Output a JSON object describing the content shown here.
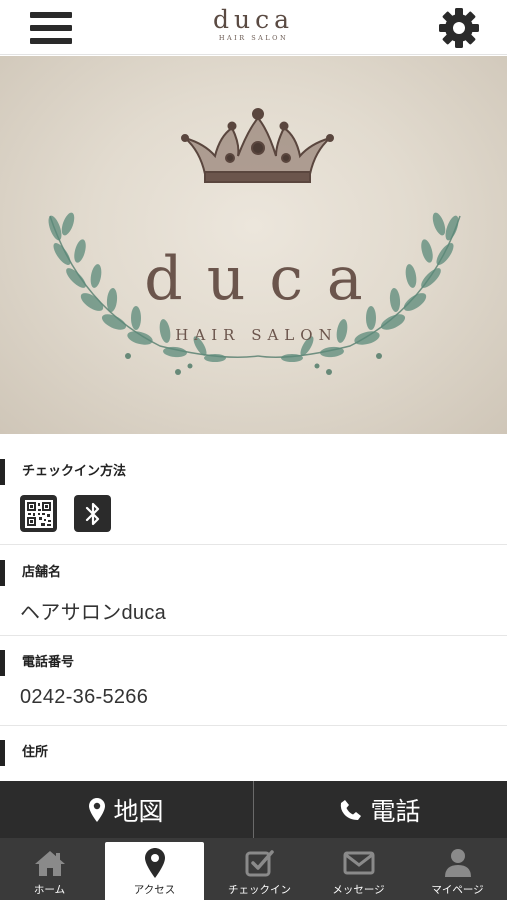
{
  "header": {
    "logo_main": "duca",
    "logo_sub": "HAIR SALON",
    "menu_icon": "hamburger-menu-icon",
    "settings_icon": "gear-icon"
  },
  "hero": {
    "title": "duca",
    "subtitle": "HAIR SALON"
  },
  "sections": {
    "checkin_method": {
      "label": "チェックイン方法",
      "icons": [
        "qr-code-icon",
        "bluetooth-icon"
      ]
    },
    "shop_name": {
      "label": "店舗名",
      "value": "ヘアサロンduca"
    },
    "phone": {
      "label": "電話番号",
      "value": "0242-36-5266"
    },
    "address": {
      "label": "住所",
      "value": ""
    }
  },
  "action_bar": {
    "map_label": "地図",
    "phone_label": "電話"
  },
  "tabs": [
    {
      "label": "ホーム",
      "icon": "home-icon",
      "active": false
    },
    {
      "label": "アクセス",
      "icon": "map-pin-icon",
      "active": true
    },
    {
      "label": "チェックイン",
      "icon": "checkbox-icon",
      "active": false
    },
    {
      "label": "メッセージ",
      "icon": "envelope-icon",
      "active": false
    },
    {
      "label": "マイページ",
      "icon": "user-icon",
      "active": false
    }
  ],
  "colors": {
    "dark_bar": "#2c2c2c",
    "tab_bar": "#3a3a3a",
    "brand_brown": "#6b554c",
    "leaf_green": "#5b8a7a"
  }
}
